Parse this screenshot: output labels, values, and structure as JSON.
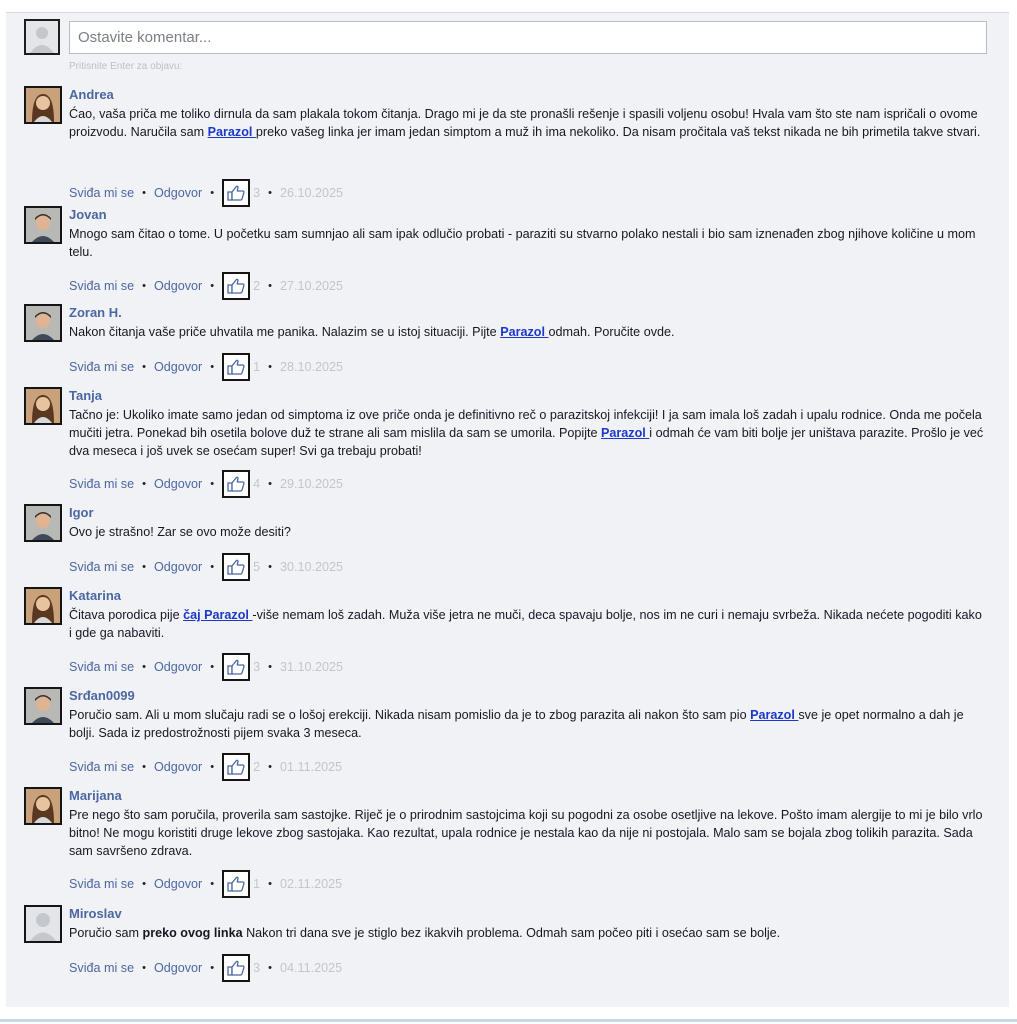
{
  "composer": {
    "placeholder": "Ostavite komentar...",
    "hint": "Pritisnite Enter za objavu:"
  },
  "actions": {
    "like_label": "Sviđa mi se",
    "reply_label": "Odgovor",
    "separator": "•"
  },
  "colors": {
    "author": "#4b67a1",
    "link": "#1b38c9",
    "meta": "#c2c5ca",
    "panel": "#f1f2f5"
  },
  "comments": [
    {
      "author": "Andrea",
      "avatar_icon": "woman-avatar",
      "parts": [
        {
          "t": "Ćao, vaša priča me toliko dirnula da sam plakala tokom čitanja. Drago mi je da ste pronašli rešenje i spasili voljenu osobu! Hvala vam što ste nam ispričali o ovome proizvodu. Naručila sam "
        },
        {
          "link": "Parazol "
        },
        {
          "t": "preko vašeg linka jer imam jedan simptom a muž ih ima nekoliko. Da nisam pročitala vaš tekst nikada ne bih primetila takve stvari."
        }
      ],
      "likes": "3",
      "date": "26.10.2025"
    },
    {
      "author": "Jovan",
      "avatar_icon": "man-avatar",
      "parts": [
        {
          "t": "Mnogo sam čitao o tome. U početku sam sumnjao ali sam ipak odlučio probati - paraziti su stvarno polako nestali i bio sam iznenađen zbog njihove količine u mom telu."
        }
      ],
      "likes": "2",
      "date": "27.10.2025"
    },
    {
      "author": "Zoran H.",
      "avatar_icon": "man-avatar",
      "parts": [
        {
          "t": "Nakon čitanja vaše priče uhvatila me panika. Nalazim se u istoj situaciji. Pijte "
        },
        {
          "link": "Parazol "
        },
        {
          "t": "odmah. Poručite ovde."
        }
      ],
      "likes": "1",
      "date": "28.10.2025"
    },
    {
      "author": "Tanja",
      "avatar_icon": "woman-avatar",
      "parts": [
        {
          "t": "Tačno je: Ukoliko imate samo jedan od simptoma iz ove priče onda je definitivno reč o parazitskoj infekciji! I ja sam imala loš zadah i upalu rodnice. Onda me počela mučiti jetra. Ponekad bih osetila bolove duž te strane ali sam mislila da sam se umorila. Popijte "
        },
        {
          "link": "Parazol "
        },
        {
          "t": "i odmah će vam biti bolje jer uništava parazite. Prošlo je već dva meseca i još uvek se osećam super! Svi ga trebaju probati!"
        }
      ],
      "likes": "4",
      "date": "29.10.2025"
    },
    {
      "author": "Igor",
      "avatar_icon": "man-avatar",
      "parts": [
        {
          "t": "Ovo je strašno! Zar se ovo može desiti?"
        }
      ],
      "likes": "5",
      "date": "30.10.2025"
    },
    {
      "author": "Katarina",
      "avatar_icon": "woman-avatar",
      "parts": [
        {
          "t": "Čitava porodica pije "
        },
        {
          "link": "čaj Parazol "
        },
        {
          "t": "-više nemam loš zadah. Muža više jetra ne muči, deca spavaju bolje, nos im ne curi i nemaju svrbeža. Nikada nećete pogoditi kako i gde ga nabaviti."
        }
      ],
      "likes": "3",
      "date": "31.10.2025"
    },
    {
      "author": "Srđan0099",
      "avatar_icon": "man-avatar",
      "parts": [
        {
          "t": "Poručio sam. Ali u mom slučaju radi se o lošoj erekciji. Nikada nisam pomislio da je to zbog parazita ali nakon što sam pio "
        },
        {
          "link": "Parazol "
        },
        {
          "t": "sve je opet normalno a dah je bolji. Sada iz predostrožnosti pijem svaka 3 meseca."
        }
      ],
      "likes": "2",
      "date": "01.11.2025"
    },
    {
      "author": "Marijana",
      "avatar_icon": "woman-avatar",
      "parts": [
        {
          "t": "Pre nego što sam poručila, proverila sam sastojke. Riječ je o prirodnim sastojcima koji su pogodni za osobe osetljive na lekove. Pošto imam alergije to mi je bilo vrlo bitno! Ne mogu koristiti druge lekove zbog sastojaka. Kao rezultat, upala rodnice je nestala kao da nije ni postojala. Malo sam se bojala zbog tolikih parazita. Sada sam savršeno zdrava."
        }
      ],
      "likes": "1",
      "date": "02.11.2025"
    },
    {
      "author": "Miroslav",
      "avatar_icon": "default-avatar",
      "parts": [
        {
          "t": "Poručio sam "
        },
        {
          "bold": "preko ovog linka"
        },
        {
          "t": " Nakon tri dana sve je stiglo bez ikakvih problema. Odmah sam počeo piti i osećao sam se bolje."
        }
      ],
      "likes": "3",
      "date": "04.11.2025"
    }
  ]
}
